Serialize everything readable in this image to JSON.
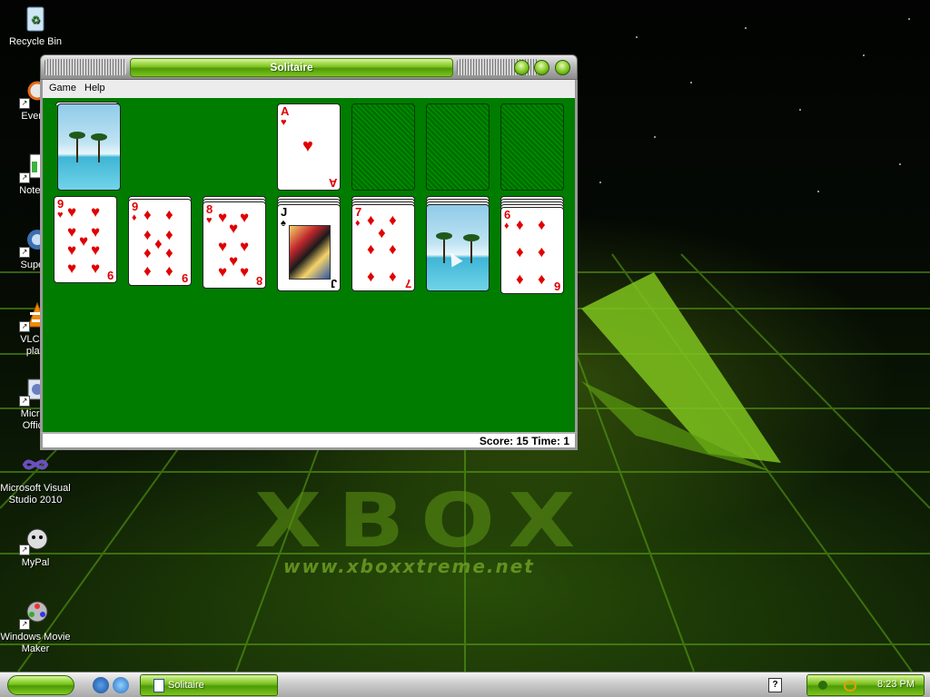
{
  "desktop": {
    "watermark": "XBOX",
    "watermark_url": "www.xboxxtreme.net",
    "icons": [
      {
        "label": "Recycle Bin",
        "icon": "recycle-bin-icon"
      },
      {
        "label": "Everyt",
        "icon": "everything-icon"
      },
      {
        "label": "Notepa",
        "icon": "notepad-icon"
      },
      {
        "label": "Superr",
        "icon": "super-icon"
      },
      {
        "label": "VLC m\nplay",
        "icon": "vlc-icon"
      },
      {
        "label": "Micros\nOffice",
        "icon": "office-icon"
      },
      {
        "label": "Microsoft Visual\nStudio 2010",
        "icon": "visual-studio-icon"
      },
      {
        "label": "MyPal",
        "icon": "mypal-icon"
      },
      {
        "label": "Windows Movie\nMaker",
        "icon": "movie-maker-icon"
      }
    ]
  },
  "window": {
    "title": "Solitaire",
    "menu": [
      "Game",
      "Help"
    ],
    "status": "Score: 15 Time: 1"
  },
  "game": {
    "foundation_ace": {
      "rank": "A",
      "suit": "♥"
    },
    "tableau": [
      {
        "rank": "9",
        "suit": "♥",
        "color": "red"
      },
      {
        "rank": "9",
        "suit": "♦",
        "color": "red"
      },
      {
        "rank": "8",
        "suit": "♥",
        "color": "red"
      },
      {
        "rank": "J",
        "suit": "♠",
        "color": "black"
      },
      {
        "rank": "7",
        "suit": "♦",
        "color": "red"
      },
      {
        "rank": "",
        "suit": "",
        "color": "back"
      },
      {
        "rank": "6",
        "suit": "♦",
        "color": "red"
      }
    ]
  },
  "taskbar": {
    "task_label": "Solitaire",
    "help_glyph": "?",
    "clock": "8:23 PM"
  },
  "colors": {
    "felt": "#007c00",
    "accent_green": "#77bf19"
  }
}
